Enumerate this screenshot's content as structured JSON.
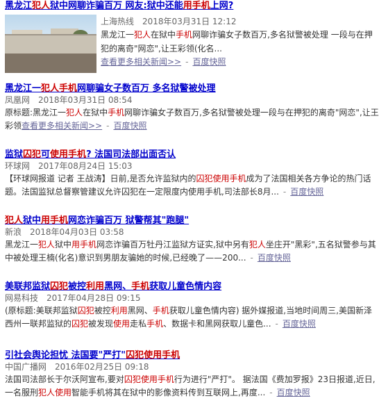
{
  "results": [
    {
      "title": [
        {
          "t": "黑龙江",
          "h": false
        },
        {
          "t": "犯人",
          "h": true
        },
        {
          "t": "狱中网聊诈骗百万 网友:狱中还能",
          "h": false
        },
        {
          "t": "用手机",
          "h": true
        },
        {
          "t": "上网?",
          "h": false
        }
      ],
      "source": "上海热线",
      "time": "2018年03月31日 12:12",
      "abstract": [
        {
          "t": "黑龙江一",
          "h": false
        },
        {
          "t": "犯人",
          "h": true
        },
        {
          "t": "在狱中",
          "h": false
        },
        {
          "t": "手机",
          "h": true
        },
        {
          "t": "网聊诈骗女子数百万,多名狱警被处理 一段与在押犯的离奇\"网恋\",让王彩领(化名...",
          "h": false
        }
      ],
      "more_label": "查看更多相关新闻>>",
      "snapshot_label": "百度快照"
    },
    {
      "title": [
        {
          "t": "黑龙江一",
          "h": false
        },
        {
          "t": "犯人手机",
          "h": true
        },
        {
          "t": "网聊骗女子数百万 多名狱警被处理",
          "h": false
        }
      ],
      "source": "凤凰网",
      "time": "2018年03月31日 08:54",
      "abstract": [
        {
          "t": "原标题:黑龙江一",
          "h": false
        },
        {
          "t": "犯人",
          "h": true
        },
        {
          "t": "在狱中",
          "h": false
        },
        {
          "t": "手机",
          "h": true
        },
        {
          "t": "网聊诈骗女子数百万,多名狱警被处理一段与在押犯的离奇\"网恋\",让王彩领",
          "h": false
        }
      ],
      "more_label": "查看更多相关新闻>>",
      "snapshot_label": "百度快照"
    },
    {
      "title": [
        {
          "t": "监狱",
          "h": false
        },
        {
          "t": "囚犯",
          "h": true
        },
        {
          "t": "可",
          "h": false
        },
        {
          "t": "使用手机",
          "h": true
        },
        {
          "t": "? 法国司法部出面否认",
          "h": false
        }
      ],
      "source": "环球网",
      "time": "2017年08月24日 15:03",
      "abstract": [
        {
          "t": "【环球网报道 记者 王战涛】日前,是否允许监狱内的",
          "h": false
        },
        {
          "t": "囚犯使用手机",
          "h": true
        },
        {
          "t": "成为了法国相关各方争论的热门话题。法国监狱总督察管建议允许囚犯在一定限度内使用手机,司法部长8月...",
          "h": false
        }
      ],
      "snapshot_label": "百度快照"
    },
    {
      "title": [
        {
          "t": "犯人",
          "h": true
        },
        {
          "t": "狱中",
          "h": false
        },
        {
          "t": "用手机",
          "h": true
        },
        {
          "t": "网恋诈骗百万 狱警帮其\"跑腿\"",
          "h": false
        }
      ],
      "source": "新浪",
      "time": "2018年04月03日 03:58",
      "abstract": [
        {
          "t": "黑龙江一",
          "h": false
        },
        {
          "t": "犯人",
          "h": true
        },
        {
          "t": "狱中",
          "h": false
        },
        {
          "t": "用手机",
          "h": true
        },
        {
          "t": "网恋诈骗百万牡丹江监狱方证实,狱中另有",
          "h": false
        },
        {
          "t": "犯人",
          "h": true
        },
        {
          "t": "坐庄开\"黑彩\",五名狱警参与其中被处理王楠(化名)意识到男朋友骗她的时候,已经晚了——200...",
          "h": false
        }
      ],
      "snapshot_label": "百度快照"
    },
    {
      "title": [
        {
          "t": "美联邦监狱",
          "h": false
        },
        {
          "t": "囚犯",
          "h": true
        },
        {
          "t": "被控",
          "h": false
        },
        {
          "t": "利用",
          "h": true
        },
        {
          "t": "黑网、",
          "h": false
        },
        {
          "t": "手机",
          "h": true
        },
        {
          "t": "获取儿童色情内容",
          "h": false
        }
      ],
      "source": "网易科技",
      "time": "2017年04月28日 09:15",
      "abstract": [
        {
          "t": "(原标题:美联邦监狱",
          "h": false
        },
        {
          "t": "囚犯",
          "h": true
        },
        {
          "t": "被控",
          "h": false
        },
        {
          "t": "利用",
          "h": true
        },
        {
          "t": "黑网、",
          "h": false
        },
        {
          "t": "手机",
          "h": true
        },
        {
          "t": "获取儿童色情内容) 据外媒报道,当地时间周三,美国新泽西州一联邦监狱的",
          "h": false
        },
        {
          "t": "囚犯",
          "h": true
        },
        {
          "t": "被发现",
          "h": false
        },
        {
          "t": "使用",
          "h": true
        },
        {
          "t": "走私",
          "h": false
        },
        {
          "t": "手机",
          "h": true
        },
        {
          "t": "、数据卡和黑网获取儿童色...",
          "h": false
        }
      ],
      "snapshot_label": "百度快照"
    },
    {
      "title": [
        {
          "t": "引社会舆论担忧 法国要\"严打\"",
          "h": false
        },
        {
          "t": "囚犯使用手机",
          "h": true
        }
      ],
      "source": "中国广播网",
      "time": "2016年02月25日 09:18",
      "abstract": [
        {
          "t": "法国司法部长于尔沃阿宣布,要对",
          "h": false
        },
        {
          "t": "囚犯使用手机",
          "h": true
        },
        {
          "t": "行为进行\"严打\"。 据法国《费加罗报》23日报道,近日,一名服刑",
          "h": false
        },
        {
          "t": "犯人使用",
          "h": true
        },
        {
          "t": "智能手机将其在狱中的影像资料传到互联网上,再度...",
          "h": false
        }
      ],
      "snapshot_label": "百度快照"
    }
  ]
}
